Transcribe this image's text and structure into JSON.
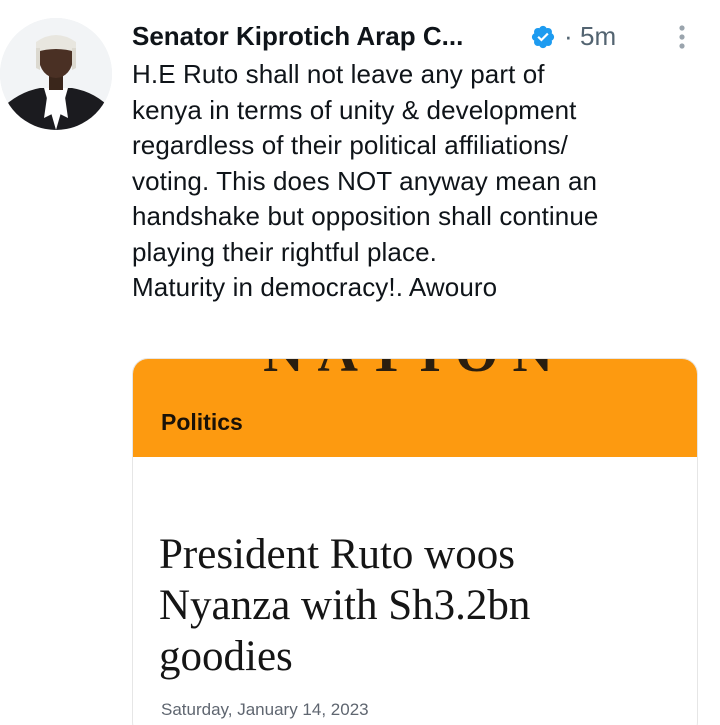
{
  "tweet": {
    "author_name": "Senator Kiprotich Arap C...",
    "separator": "·",
    "timestamp": "5m",
    "text_lines": [
      "H.E Ruto shall not leave any part of",
      "kenya in terms of unity & development",
      "regardless of their political affiliations/",
      "voting. This does NOT anyway mean an",
      "handshake but opposition shall continue",
      "playing their rightful place.",
      "Maturity in democracy!. Awouro"
    ],
    "icons": {
      "verified": "verified-badge-icon",
      "more": "more-options-icon"
    }
  },
  "card": {
    "masthead": "NATION",
    "section": "Politics",
    "headline_lines": [
      "President Ruto woos",
      "Nyanza with Sh3.2bn",
      "goodies"
    ],
    "date": "Saturday, January 14, 2023"
  },
  "colors": {
    "verified_blue": "#1d9bf0",
    "banner_orange": "#fd9a10",
    "muted_text": "#536471"
  }
}
